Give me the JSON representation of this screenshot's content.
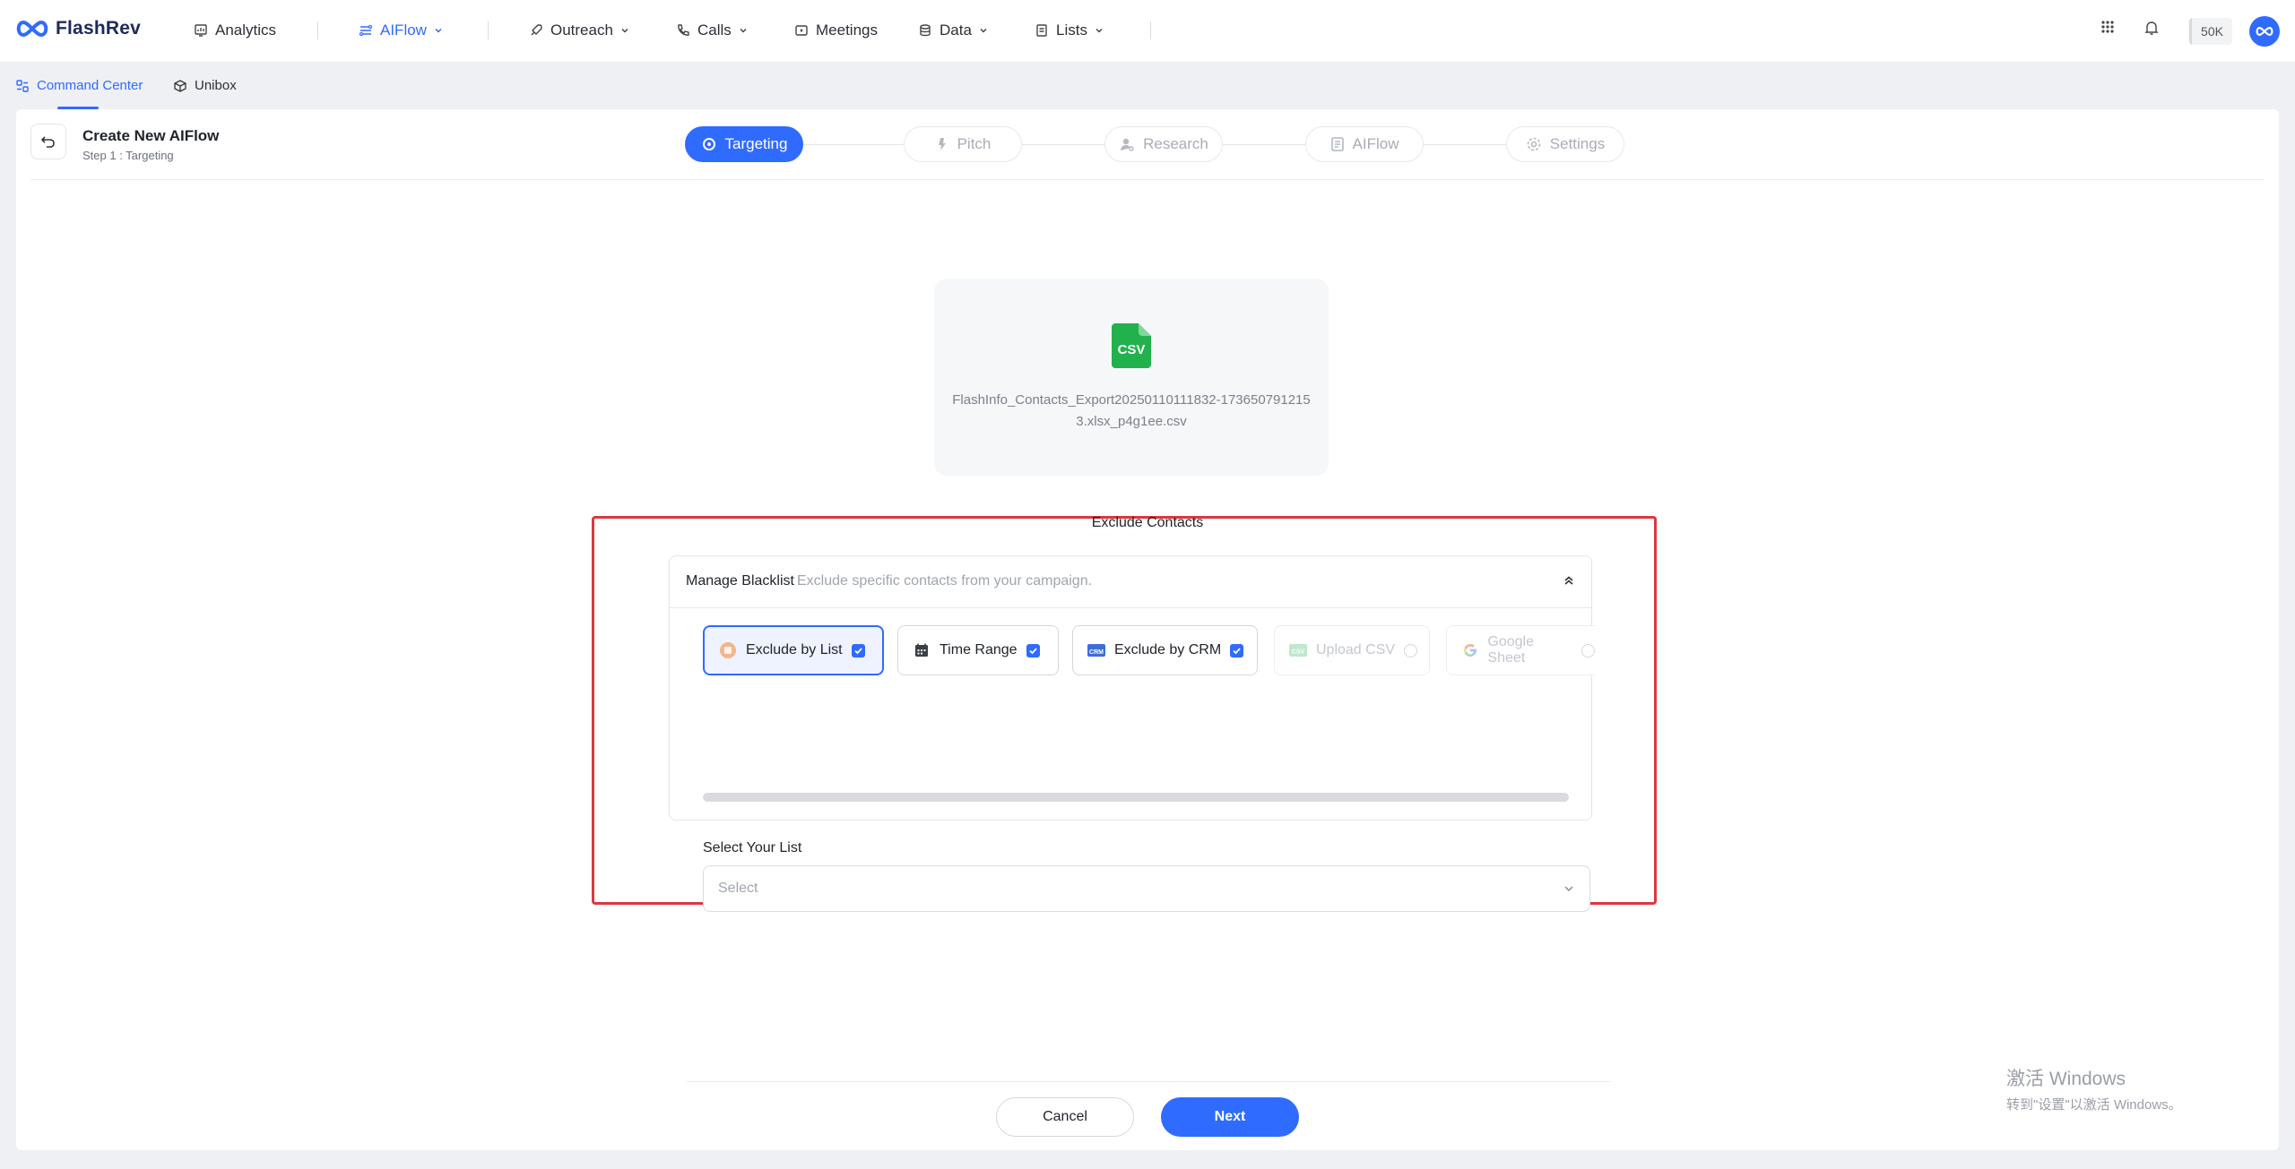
{
  "brand": {
    "name": "FlashRev"
  },
  "topnav": {
    "items": [
      {
        "label": "Analytics"
      },
      {
        "label": "AIFlow"
      },
      {
        "label": "Outreach"
      },
      {
        "label": "Calls"
      },
      {
        "label": "Meetings"
      },
      {
        "label": "Data"
      },
      {
        "label": "Lists"
      }
    ],
    "credits": "50K"
  },
  "subnav": {
    "items": [
      {
        "label": "Command Center"
      },
      {
        "label": "Unibox"
      }
    ]
  },
  "header": {
    "title": "Create New AIFlow",
    "subtitle": "Step 1 : Targeting"
  },
  "stepper": [
    {
      "label": "Targeting",
      "active": true
    },
    {
      "label": "Pitch",
      "active": false
    },
    {
      "label": "Research",
      "active": false
    },
    {
      "label": "AIFlow",
      "active": false
    },
    {
      "label": "Settings",
      "active": false
    }
  ],
  "file": {
    "icon_text": "CSV",
    "name": "FlashInfo_Contacts_Export20250110111832-1736507912153.xlsx_p4g1ee.csv"
  },
  "exclude": {
    "title": "Exclude Contacts",
    "blacklist_title": "Manage Blacklist",
    "blacklist_desc": "Exclude specific contacts from your campaign.",
    "options": [
      {
        "label": "Exclude by List",
        "checked": true,
        "selected": true
      },
      {
        "label": "Time Range",
        "checked": true
      },
      {
        "label": "Exclude by CRM",
        "checked": true
      },
      {
        "label": "Upload CSV",
        "checked": false,
        "disabled": true
      },
      {
        "label": "Google Sheet",
        "checked": false,
        "disabled": true
      }
    ],
    "list_label": "Select Your List",
    "select_placeholder": "Select"
  },
  "footer": {
    "cancel": "Cancel",
    "next": "Next"
  },
  "watermark": {
    "line1": "激活 Windows",
    "line2": "转到\"设置\"以激活 Windows。"
  },
  "colors": {
    "primary": "#2f6bff",
    "highlight": "#d8393f",
    "csv_green": "#22b14c"
  }
}
